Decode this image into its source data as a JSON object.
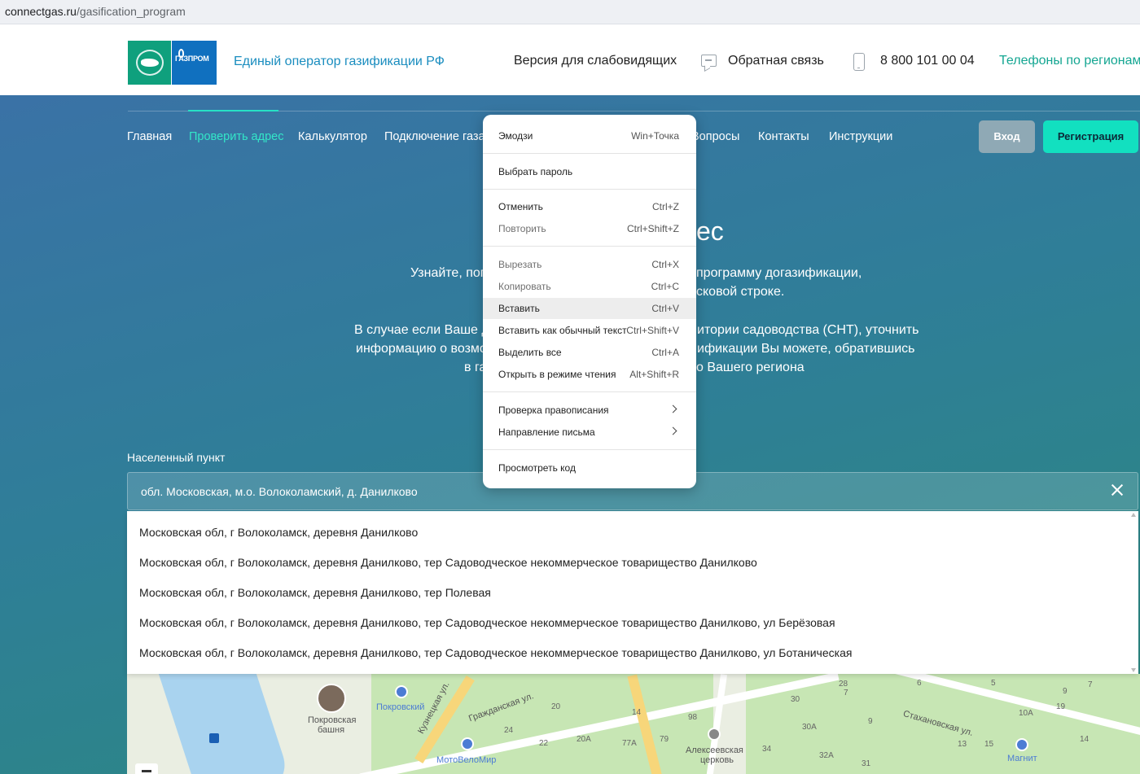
{
  "browser": {
    "url_host": "connectgas.ru",
    "url_path": "/gasification_program"
  },
  "header": {
    "brand": "Единый оператор газификации РФ",
    "logo_text": "ГАЗПРОМ",
    "vision_link": "Версия для слабовидящих",
    "feedback_link": "Обратная связь",
    "phone": "8 800 101 00 04",
    "regions_link": "Телефоны по регионам"
  },
  "nav": {
    "items": [
      "Главная",
      "Проверить адрес",
      "Калькулятор",
      "Подключение газа",
      "Вопросы",
      "Контакты",
      "Инструкции"
    ],
    "active": "Проверить адрес",
    "login": "Вход",
    "register": "Регистрация"
  },
  "hero": {
    "title_visible": "ес",
    "line1_left": "Узнайте, пог",
    "line1_right": "программу догазификации,",
    "line2_right": "сковой строке.",
    "line3_left": "В случае если Ваше д",
    "line3_right": "итории садоводства (СНТ), уточнить",
    "line4_left": "информацию о возмо",
    "line4_right": "ификации Вы можете, обратившись",
    "line5_left": "в га",
    "line5_right": "о Вашего региона"
  },
  "search": {
    "label": "Населенный пункт",
    "value": "обл. Московская, м.о. Волоколамский, д. Данилково"
  },
  "suggestions": [
    "Московская обл, г Волоколамск, деревня Данилково",
    "Московская обл, г Волоколамск, деревня Данилково, тер Садоводческое некоммерческое товарищество Данилково",
    "Московская обл, г Волоколамск, деревня Данилково, тер Полевая",
    "Московская обл, г Волоколамск, деревня Данилково, тер Садоводческое некоммерческое товарищество Данилково, ул Берёзовая",
    "Московская обл, г Волоколамск, деревня Данилково, тер Садоводческое некоммерческое товарищество Данилково, ул Ботаническая"
  ],
  "map": {
    "labels": {
      "tower": "Покровская башня",
      "tower_line1": "Покровская",
      "tower_line2": "башня",
      "pokrovsky": "Покровский",
      "kuznetskaya": "Кузнецкая ул.",
      "grazhdanskaya": "Гражданская ул.",
      "motovelomir": "МотоВелоМир",
      "church_line1": "Алексеевская",
      "church_line2": "церковь",
      "stakhanovskaya": "Стахановская ул.",
      "magnit": "Магнит"
    },
    "numbers": [
      "20",
      "14",
      "98",
      "24",
      "22",
      "20А",
      "77А",
      "79",
      "34",
      "28",
      "30",
      "7",
      "30А",
      "9",
      "6",
      "10А",
      "13",
      "15",
      "14",
      "32А",
      "31",
      "9",
      "5",
      "7",
      "19"
    ]
  },
  "context_menu": {
    "items": [
      {
        "label": "Эмодзи",
        "shortcut": "Win+Точка"
      },
      {
        "label": "Выбрать пароль",
        "shortcut": ""
      },
      {
        "label": "Отменить",
        "shortcut": "Ctrl+Z"
      },
      {
        "label": "Повторить",
        "shortcut": "Ctrl+Shift+Z"
      },
      {
        "label": "Вырезать",
        "shortcut": "Ctrl+X"
      },
      {
        "label": "Копировать",
        "shortcut": "Ctrl+C"
      },
      {
        "label": "Вставить",
        "shortcut": "Ctrl+V"
      },
      {
        "label": "Вставить как обычный текст",
        "shortcut": "Ctrl+Shift+V"
      },
      {
        "label": "Выделить все",
        "shortcut": "Ctrl+A"
      },
      {
        "label": "Открыть в режиме чтения",
        "shortcut": "Alt+Shift+R"
      },
      {
        "label": "Проверка правописания",
        "shortcut": ""
      },
      {
        "label": "Направление письма",
        "shortcut": ""
      },
      {
        "label": "Просмотреть код",
        "shortcut": ""
      }
    ]
  },
  "colors": {
    "accent": "#12e0c0",
    "brand_blue": "#1a8dbf",
    "regions_green": "#14a692"
  }
}
